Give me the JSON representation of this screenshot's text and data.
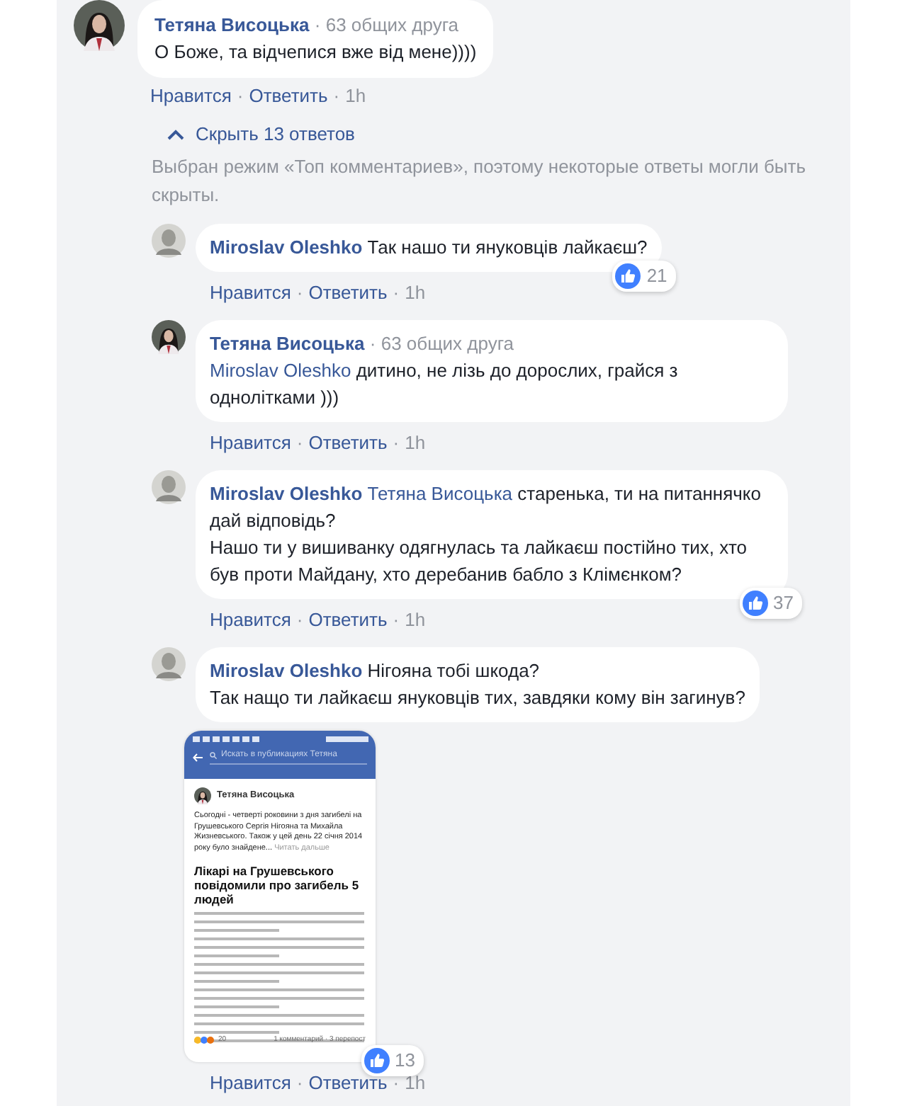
{
  "comment": {
    "author": "Тетяна Висоцька",
    "kind": "woman",
    "mutual": "· 63 общих друга",
    "text": "О Боже, та відчепися вже від мене))))",
    "actions": [
      {
        "kind": "like",
        "label": "Нравится"
      },
      {
        "kind": "dot",
        "label": "·"
      },
      {
        "kind": "reply",
        "label": "Ответить"
      },
      {
        "kind": "dot",
        "label": "·"
      },
      {
        "kind": "time",
        "label": "1h"
      }
    ]
  },
  "replies_toggle": {
    "label": "Скрыть 13 ответов",
    "expanded": true
  },
  "notice": "Выбран режим «Топ комментариев», поэтому некоторые ответы могли быть скрыты.",
  "replies": [
    {
      "author": "Miroslav Oleshko",
      "kind": "man",
      "text": "Так нашо ти януковців лайкаєш?",
      "reactions": "21",
      "actions": [
        {
          "kind": "like",
          "label": "Нравится"
        },
        {
          "kind": "dot",
          "label": "·"
        },
        {
          "kind": "reply",
          "label": "Ответить"
        },
        {
          "kind": "dot",
          "label": "·"
        },
        {
          "kind": "time",
          "label": "1h"
        }
      ]
    },
    {
      "author": "Тетяна Висоцька",
      "kind": "woman",
      "mutual": "· 63 общих друга",
      "mention": "Miroslav Oleshko",
      "text": "дитино, не лізь до дорослих, грайся з однолітками )))",
      "actions": [
        {
          "kind": "like",
          "label": "Нравится"
        },
        {
          "kind": "dot",
          "label": "·"
        },
        {
          "kind": "reply",
          "label": "Ответить"
        },
        {
          "kind": "dot",
          "label": "·"
        },
        {
          "kind": "time",
          "label": "1h"
        }
      ]
    },
    {
      "author": "Miroslav Oleshko",
      "kind": "man",
      "mention": "Тетяна Висоцька",
      "text": "старенька, ти на питаннячко дай відповідь?\nНашо ти у вишиванку одягнулась та лайкаєш постійно тих, хто був проти Майдану, хто деребанив бабло з Клімєнком?",
      "reactions": "37",
      "actions": [
        {
          "kind": "like",
          "label": "Нравится"
        },
        {
          "kind": "dot",
          "label": "·"
        },
        {
          "kind": "reply",
          "label": "Ответить"
        },
        {
          "kind": "dot",
          "label": "·"
        },
        {
          "kind": "time",
          "label": "1h"
        }
      ]
    },
    {
      "author": "Miroslav Oleshko",
      "kind": "man",
      "text": "Нігояна тобі шкода?\nТак нащо ти лайкаєш януковців тих, завдяки кому він загинув?",
      "actions": [
        {
          "kind": "like",
          "label": "Нравится"
        },
        {
          "kind": "dot",
          "label": "·"
        },
        {
          "kind": "reply",
          "label": "Ответить"
        },
        {
          "kind": "dot",
          "label": "·"
        },
        {
          "kind": "time",
          "label": "1h"
        }
      ],
      "attachment": {
        "search_placeholder": "Искать в публикациях Тетяна",
        "author": "Тетяна Висоцька",
        "post_text": "Сьогодні - четверті роковини з дня загибелі на Грушевського Сергія Нігояна та Михайла Жизневського. Також у цей день 22 січня 2014 року було знайдене...",
        "read_more": "Читать дальше",
        "headline": "Лікарі на Грушевського повідомили про загибель 5 людей",
        "reaction_count": "20",
        "stats": "1 комментарий · 3 перепост",
        "reactions": "13"
      }
    }
  ]
}
